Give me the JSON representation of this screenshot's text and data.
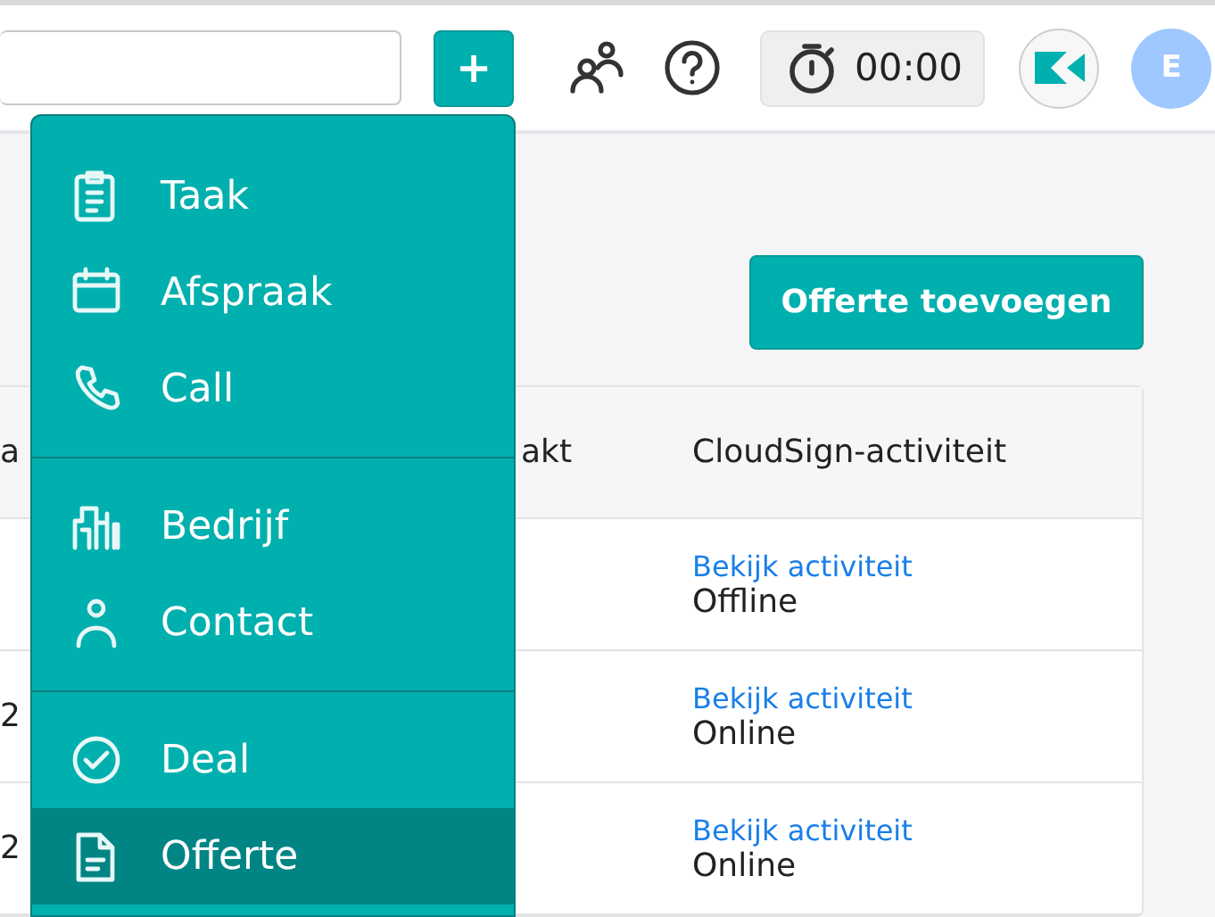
{
  "topbar": {
    "add_button": "+",
    "timer": "00:00",
    "avatar": "E"
  },
  "add_button": "Offerte toevoegen",
  "table": {
    "columns": [
      "a",
      "akt",
      "CloudSign-activiteit"
    ],
    "rows": [
      {
        "column_1": "",
        "activity_link": "Bekijk activiteit",
        "activity_status": "Offline"
      },
      {
        "column_1": "2",
        "activity_link": "Bekijk activiteit",
        "activity_status": "Online"
      },
      {
        "column_1": "2",
        "activity_link": "Bekijk activiteit",
        "activity_status": "Online"
      }
    ]
  },
  "menu": {
    "groups": [
      [
        {
          "kind": "task",
          "label": "Taak",
          "selected": false
        },
        {
          "kind": "appointment",
          "label": "Afspraak",
          "selected": false
        },
        {
          "kind": "call",
          "label": "Call",
          "selected": false
        }
      ],
      [
        {
          "kind": "company",
          "label": "Bedrijf",
          "selected": false
        },
        {
          "kind": "contact",
          "label": "Contact",
          "selected": false
        }
      ],
      [
        {
          "kind": "deal",
          "label": "Deal",
          "selected": false
        },
        {
          "kind": "quote",
          "label": "Offerte",
          "selected": true
        }
      ]
    ]
  }
}
